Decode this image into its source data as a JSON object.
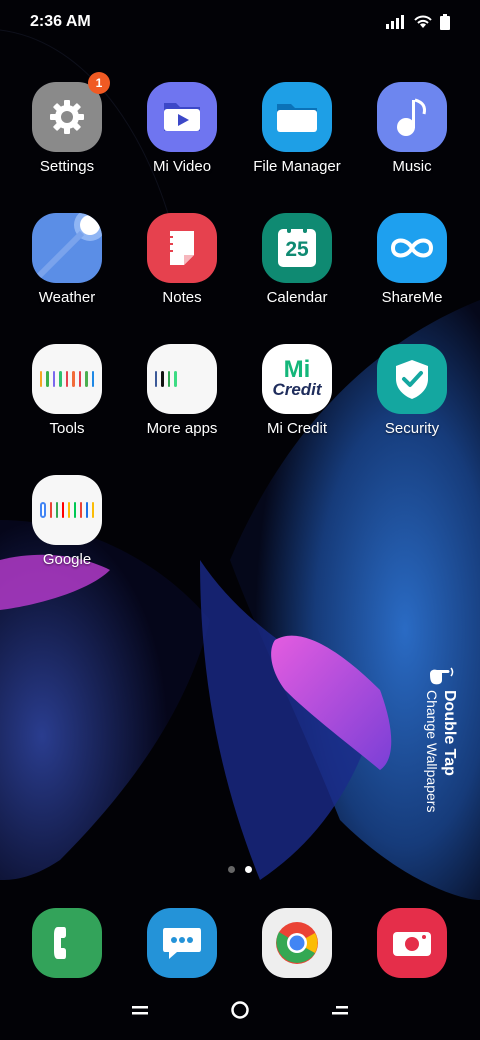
{
  "status_bar": {
    "time": "2:36 AM"
  },
  "apps": [
    {
      "label": "Settings",
      "icon": "gear-icon",
      "badge": "1"
    },
    {
      "label": "Mi Video",
      "icon": "video-icon"
    },
    {
      "label": "File Manager",
      "icon": "folder-icon"
    },
    {
      "label": "Music",
      "icon": "music-icon"
    },
    {
      "label": "Weather",
      "icon": "weather-icon"
    },
    {
      "label": "Notes",
      "icon": "notes-icon"
    },
    {
      "label": "Calendar",
      "icon": "calendar-icon",
      "date": "25"
    },
    {
      "label": "ShareMe",
      "icon": "infinity-icon"
    },
    {
      "label": "Tools",
      "icon": "folder-tools-icon"
    },
    {
      "label": "More apps",
      "icon": "folder-apps-icon"
    },
    {
      "label": "Mi Credit",
      "icon": "mi-credit-icon",
      "logo_top": "Mi",
      "logo_bottom": "Credit"
    },
    {
      "label": "Security",
      "icon": "shield-icon"
    },
    {
      "label": "Google",
      "icon": "folder-google-icon"
    }
  ],
  "hint": {
    "title": "Double Tap",
    "subtitle": "Change Wallpapers"
  },
  "dock": [
    {
      "name": "phone",
      "icon": "phone-icon"
    },
    {
      "name": "messages",
      "icon": "message-icon"
    },
    {
      "name": "chrome",
      "icon": "chrome-icon"
    },
    {
      "name": "camera",
      "icon": "camera-icon"
    }
  ],
  "page_indicator": {
    "pages": 2,
    "current": 2
  },
  "colors": {
    "badge": "#f05a23",
    "settings": "#8a8a8a",
    "mivideo": "#6f75f0",
    "filemanager": "#1e9fe6",
    "music": "#6d86ef",
    "weather": "#5b8ee6",
    "notes": "#e6414e",
    "calendar": "#0f8a72",
    "shareme": "#1ea0ef",
    "security": "#14a7a0",
    "phone": "#33a35a",
    "messages": "#2493d8",
    "camera": "#e52e4a"
  }
}
